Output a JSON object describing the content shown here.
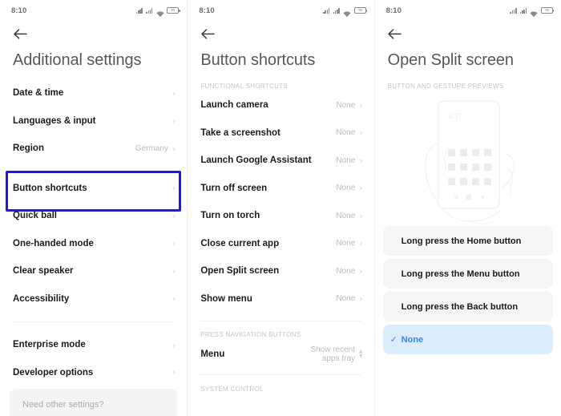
{
  "statusbar": {
    "time": "8:10",
    "battery_text": "99",
    "icons": [
      "signal-icon",
      "signal-icon",
      "wifi-icon",
      "battery-icon"
    ]
  },
  "colors": {
    "highlight": "#1f16e8",
    "accent": "#3b86e8",
    "selected_bg": "#dbecfd",
    "option_bg": "#f5f5f6",
    "title": "#55585c",
    "muted": "#b9bbbe"
  },
  "panel1": {
    "title": "Additional settings",
    "back_label": "Back",
    "rows_group1": [
      {
        "label": "Date & time",
        "value": ""
      },
      {
        "label": "Languages & input",
        "value": ""
      },
      {
        "label": "Region",
        "value": "Germany"
      }
    ],
    "rows_group2": [
      {
        "label": "Button shortcuts",
        "value": "",
        "highlighted": true
      },
      {
        "label": "Quick ball",
        "value": ""
      },
      {
        "label": "One-handed mode",
        "value": ""
      },
      {
        "label": "Clear speaker",
        "value": ""
      },
      {
        "label": "Accessibility",
        "value": ""
      }
    ],
    "rows_group3": [
      {
        "label": "Enterprise mode",
        "value": ""
      },
      {
        "label": "Developer options",
        "value": ""
      }
    ],
    "need_other_settings": "Need other settings?"
  },
  "panel2": {
    "title": "Button shortcuts",
    "back_label": "Back",
    "section1_label": "FUNCTIONAL SHORTCUTS",
    "rows_functional": [
      {
        "label": "Launch camera",
        "value": "None"
      },
      {
        "label": "Take a screenshot",
        "value": "None"
      },
      {
        "label": "Launch Google Assistant",
        "value": "None"
      },
      {
        "label": "Turn off screen",
        "value": "None"
      },
      {
        "label": "Turn on torch",
        "value": "None"
      },
      {
        "label": "Close current app",
        "value": "None"
      },
      {
        "label": "Open Split screen",
        "value": "None",
        "highlighted": true
      },
      {
        "label": "Show menu",
        "value": "None"
      }
    ],
    "section2_label": "PRESS NAVIGATION BUTTONS",
    "rows_nav": [
      {
        "label": "Menu",
        "value": "Show recent apps tray"
      }
    ],
    "section3_label": "SYSTEM CONTROL"
  },
  "panel3": {
    "title": "Open Split screen",
    "back_label": "Back",
    "section_label": "BUTTON AND GESTURE PREVIEWS",
    "illustration": {
      "name": "hand-holding-phone-illustration",
      "phone_clock": "6:37"
    },
    "options": [
      {
        "label": "Long press the Home button",
        "selected": false,
        "highlighted": false
      },
      {
        "label": "Long press the Menu button",
        "selected": false,
        "highlighted": true
      },
      {
        "label": "Long press the Back button",
        "selected": false,
        "highlighted": false
      },
      {
        "label": "None",
        "selected": true,
        "highlighted": false
      }
    ]
  }
}
